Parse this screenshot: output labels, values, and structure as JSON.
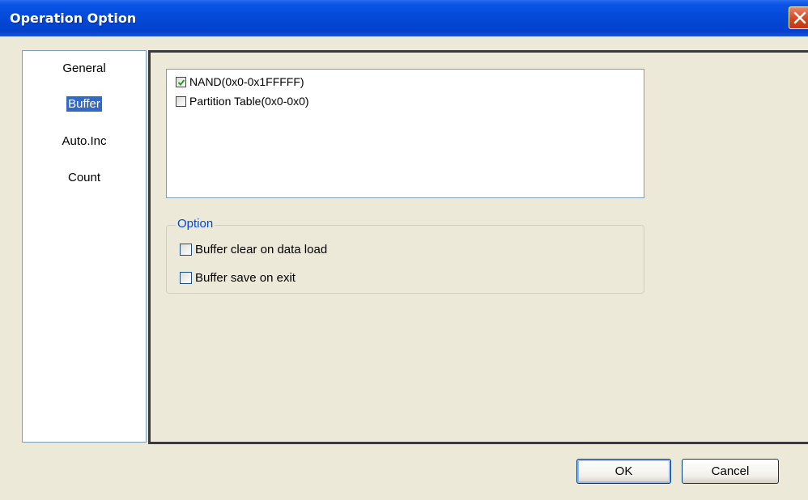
{
  "window": {
    "title": "Operation Option",
    "close_icon": "close-icon"
  },
  "nav": {
    "items": [
      {
        "label": "General",
        "selected": false
      },
      {
        "label": "Buffer",
        "selected": true
      },
      {
        "label": "Auto.Inc",
        "selected": false
      },
      {
        "label": "Count",
        "selected": false
      }
    ]
  },
  "list": {
    "items": [
      {
        "label": "NAND(0x0-0x1FFFFF)",
        "checked": true
      },
      {
        "label": "Partition Table(0x0-0x0)",
        "checked": false
      }
    ]
  },
  "option": {
    "legend": "Option",
    "items": [
      {
        "label": "Buffer clear on data load",
        "checked": false
      },
      {
        "label": "Buffer save on exit",
        "checked": false
      }
    ]
  },
  "buttons": {
    "ok": "OK",
    "cancel": "Cancel"
  },
  "colors": {
    "titlebar": "#0449d8",
    "selection": "#316ac5",
    "checkmark": "#21a121",
    "legend": "#0046d5",
    "close": "#d5461f"
  }
}
